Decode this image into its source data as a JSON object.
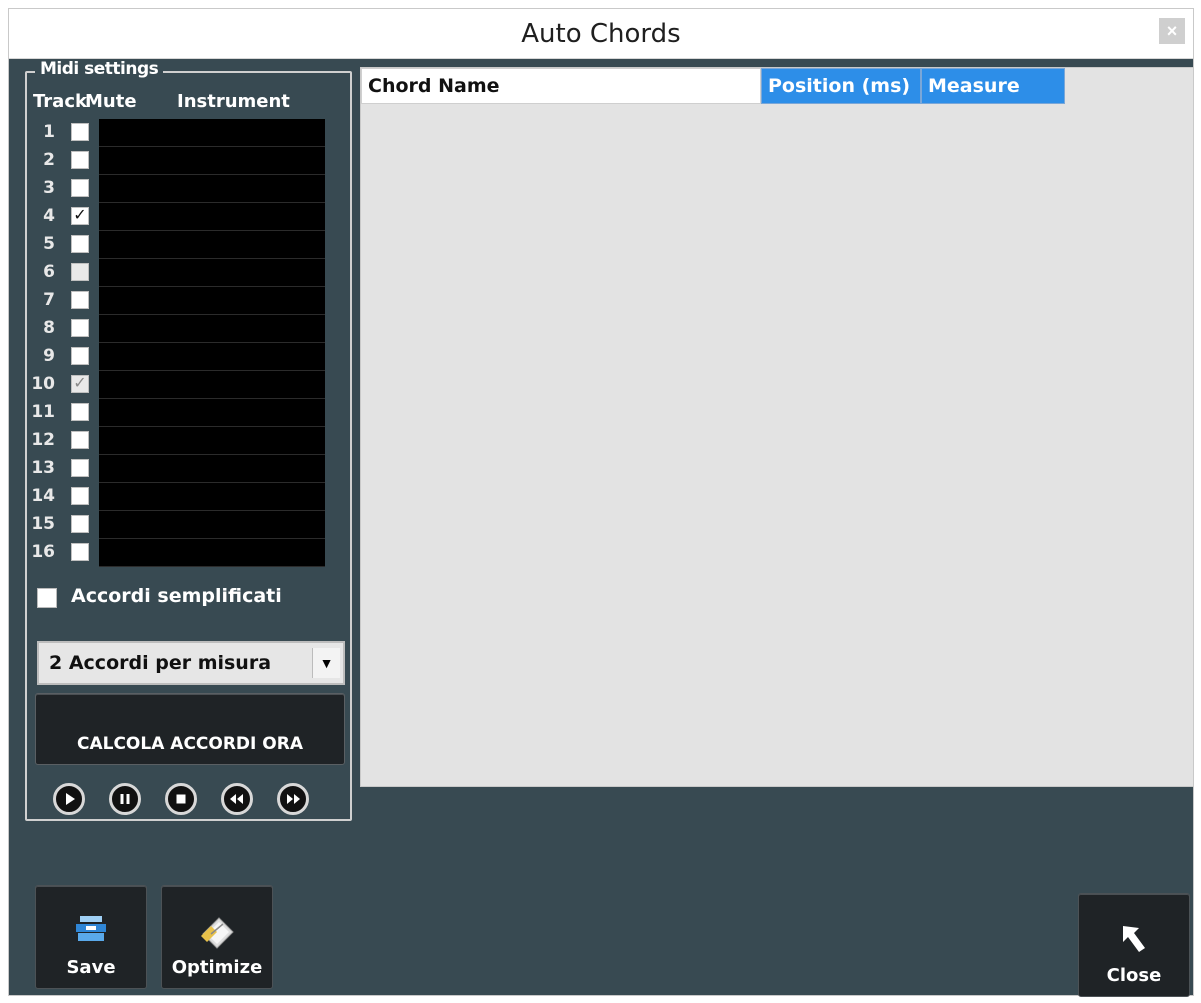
{
  "window": {
    "title": "Auto Chords",
    "close_glyph": "×"
  },
  "midi": {
    "legend": "Midi settings",
    "col_track": "Track",
    "col_mute": "Mute",
    "col_instrument": "Instrument",
    "tracks": [
      {
        "num": "1",
        "checked": false,
        "dim": false
      },
      {
        "num": "2",
        "checked": false,
        "dim": false
      },
      {
        "num": "3",
        "checked": false,
        "dim": false
      },
      {
        "num": "4",
        "checked": true,
        "dim": false
      },
      {
        "num": "5",
        "checked": false,
        "dim": false
      },
      {
        "num": "6",
        "checked": false,
        "dim": true
      },
      {
        "num": "7",
        "checked": false,
        "dim": false
      },
      {
        "num": "8",
        "checked": false,
        "dim": false
      },
      {
        "num": "9",
        "checked": false,
        "dim": false
      },
      {
        "num": "10",
        "checked": true,
        "dim": true
      },
      {
        "num": "11",
        "checked": false,
        "dim": false
      },
      {
        "num": "12",
        "checked": false,
        "dim": false
      },
      {
        "num": "13",
        "checked": false,
        "dim": false
      },
      {
        "num": "14",
        "checked": false,
        "dim": false
      },
      {
        "num": "15",
        "checked": false,
        "dim": false
      },
      {
        "num": "16",
        "checked": false,
        "dim": false
      }
    ],
    "simplified_label": "Accordi semplificati",
    "chords_per_measure": "2 Accordi per misura",
    "calc_button": "CALCOLA ACCORDI ORA",
    "transport": [
      "play-icon",
      "pause-icon",
      "stop-icon",
      "rewind-icon",
      "fast-forward-icon"
    ]
  },
  "grid": {
    "columns": [
      "Chord Name",
      "Position (ms)",
      "Measure"
    ]
  },
  "buttons": {
    "save": "Save",
    "optimize": "Optimize",
    "close": "Close"
  },
  "colors": {
    "background": "#384a52",
    "header_blue": "#2d8ee8",
    "grid_bg": "#e3e3e3"
  }
}
